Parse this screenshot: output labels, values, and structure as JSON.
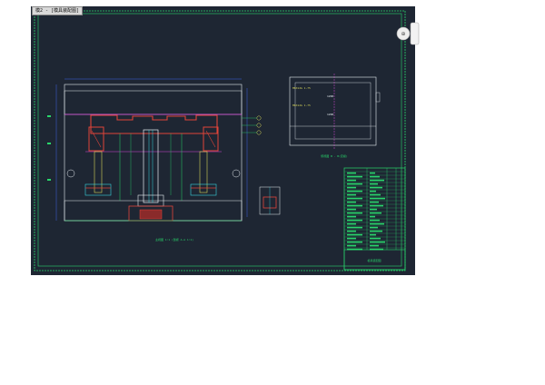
{
  "window": {
    "tab_label": "模2 - [模具装配图]"
  },
  "nav": {
    "icon": "view-cube-icon"
  },
  "drawing": {
    "main_view_caption": "主视图 1:1 (剖视 A-A 1:1)",
    "top_view_caption": "俯视图 B - B(定模)",
    "top_view_lines": [
      "M6X12G 1-75",
      "M6X12G 1-75",
      "1200",
      "1200"
    ],
    "title_block_caption": "模具装配图",
    "colors": {
      "background": "#1e2633",
      "line_green": "#29d66b",
      "line_cyan": "#37d6e0",
      "line_blue": "#3c63e6",
      "line_red": "#e0443a",
      "line_magenta": "#d846d8",
      "line_white": "#e8eef2",
      "line_yellow": "#d6d65a"
    }
  }
}
